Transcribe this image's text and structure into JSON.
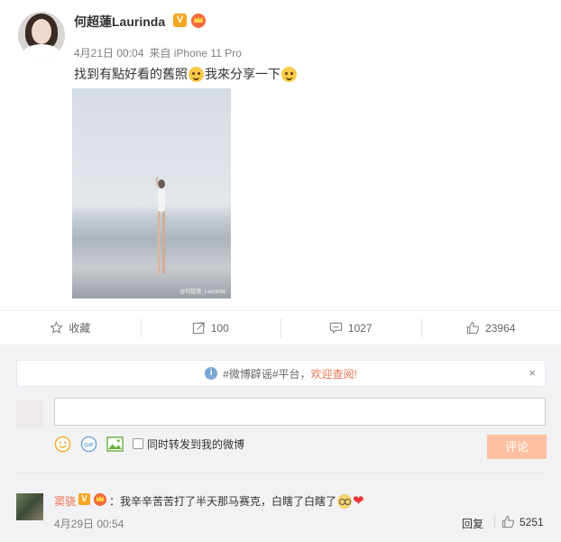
{
  "post": {
    "username": "何超蓮Laurinda",
    "verified_badge": "V",
    "timestamp": "4月21日 00:04",
    "source": "来自 iPhone 11 Pro",
    "text_part1": "找到有點好看的舊照",
    "text_part2": "我來分享一下",
    "photo_watermark": "@何超蓮_Laurinda"
  },
  "actions": {
    "favorite_label": "收藏",
    "repost_count": "100",
    "comment_count": "1027",
    "like_count": "23964"
  },
  "notice": {
    "prefix": "#微博辟谣#平台，",
    "link_text": "欢迎查阅!",
    "close": "×"
  },
  "composer": {
    "input_value": "",
    "gif_label": "GIF",
    "repost_checkbox_label": "同时转发到我的微博",
    "submit_label": "评论"
  },
  "comment": {
    "author": "窦骁",
    "verified_badge": "V",
    "text": "：我辛辛苦苦打了半天那马赛克，白瞎了白瞎了",
    "heart": "❤",
    "time": "4月29日 00:54",
    "reply_label": "回复",
    "like_count": "5251"
  },
  "colors": {
    "accent": "#eb7350",
    "verified": "#f5a623",
    "comment_button": "#ffc09f",
    "background_panel": "#f2f2f5"
  },
  "icons": [
    "star-icon",
    "repost-icon",
    "comment-icon",
    "like-icon",
    "info-icon",
    "close-icon",
    "smiley-icon",
    "gif-icon",
    "image-icon",
    "crown-icon"
  ]
}
